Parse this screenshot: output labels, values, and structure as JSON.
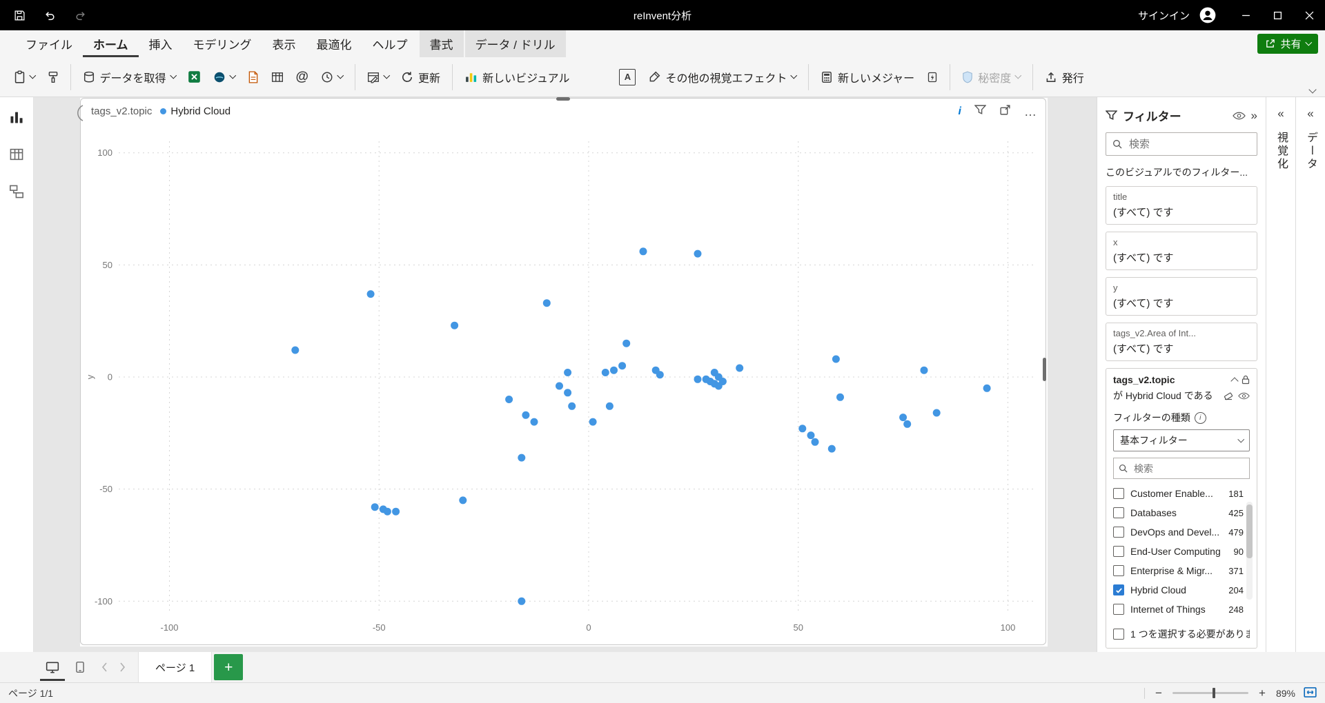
{
  "titlebar": {
    "title": "reInvent分析",
    "signin": "サインイン"
  },
  "ribbon": {
    "tabs": [
      {
        "label": "ファイル"
      },
      {
        "label": "ホーム",
        "active": true
      },
      {
        "label": "挿入"
      },
      {
        "label": "モデリング"
      },
      {
        "label": "表示"
      },
      {
        "label": "最適化"
      },
      {
        "label": "ヘルプ"
      },
      {
        "label": "書式",
        "context": true
      },
      {
        "label": "データ / ドリル",
        "context": true
      }
    ],
    "share_label": "共有"
  },
  "toolbar": {
    "get_data": "データを取得",
    "refresh": "更新",
    "new_visual": "新しいビジュアル",
    "more_visuals": "その他の視覚エフェクト",
    "new_measure": "新しいメジャー",
    "sensitivity": "秘密度",
    "publish": "発行"
  },
  "visual": {
    "legend_title": "tags_v2.topic",
    "legend_item": "Hybrid Cloud"
  },
  "chart_data": {
    "type": "scatter",
    "title": "",
    "xlabel": "",
    "ylabel": "y",
    "xlim": [
      -115,
      110
    ],
    "ylim": [
      -108,
      108
    ],
    "xticks": [
      -100,
      -50,
      0,
      50,
      100
    ],
    "yticks": [
      -100,
      -50,
      0,
      50,
      100
    ],
    "grid": "dotted",
    "legend_position": "top-left",
    "point_color": "#4296e3",
    "series": [
      {
        "name": "Hybrid Cloud",
        "points": [
          [
            -52,
            37
          ],
          [
            -70,
            12
          ],
          [
            -32,
            23
          ],
          [
            -10,
            33
          ],
          [
            13,
            56
          ],
          [
            26,
            55
          ],
          [
            9,
            15
          ],
          [
            -5,
            2
          ],
          [
            4,
            2
          ],
          [
            8,
            5
          ],
          [
            6,
            3
          ],
          [
            16,
            3
          ],
          [
            17,
            1
          ],
          [
            26,
            -1
          ],
          [
            28,
            -1
          ],
          [
            29,
            -2
          ],
          [
            30,
            2
          ],
          [
            31,
            0
          ],
          [
            30,
            -3
          ],
          [
            32,
            -2
          ],
          [
            31,
            -4
          ],
          [
            36,
            4
          ],
          [
            59,
            8
          ],
          [
            80,
            3
          ],
          [
            95,
            -5
          ],
          [
            -7,
            -4
          ],
          [
            -5,
            -7
          ],
          [
            -19,
            -10
          ],
          [
            -15,
            -17
          ],
          [
            -13,
            -20
          ],
          [
            -4,
            -13
          ],
          [
            1,
            -20
          ],
          [
            5,
            -13
          ],
          [
            -16,
            -36
          ],
          [
            51,
            -23
          ],
          [
            53,
            -26
          ],
          [
            54,
            -29
          ],
          [
            58,
            -32
          ],
          [
            60,
            -9
          ],
          [
            75,
            -18
          ],
          [
            76,
            -21
          ],
          [
            83,
            -16
          ],
          [
            -30,
            -55
          ],
          [
            -51,
            -58
          ],
          [
            -49,
            -59
          ],
          [
            -48,
            -60
          ],
          [
            -46,
            -60
          ],
          [
            -16,
            -100
          ]
        ]
      }
    ]
  },
  "filters": {
    "title": "フィルター",
    "search_placeholder": "検索",
    "section_label": "このビジュアルでのフィルター...",
    "cards": [
      {
        "field": "title",
        "state": "(すべて) です"
      },
      {
        "field": "x",
        "state": "(すべて) です"
      },
      {
        "field": "y",
        "state": "(すべて) です"
      },
      {
        "field": "tags_v2.Area of Int...",
        "state": "(すべて) です"
      }
    ],
    "active_card": {
      "field": "tags_v2.topic",
      "state": "が Hybrid Cloud である",
      "type_label": "フィルターの種類",
      "type_value": "基本フィルター",
      "search_placeholder": "検索",
      "items": [
        {
          "label": "Customer Enable...",
          "count": "181",
          "checked": false
        },
        {
          "label": "Databases",
          "count": "425",
          "checked": false
        },
        {
          "label": "DevOps and Devel...",
          "count": "479",
          "checked": false
        },
        {
          "label": "End-User Computing",
          "count": "90",
          "checked": false
        },
        {
          "label": "Enterprise & Migr...",
          "count": "371",
          "checked": false
        },
        {
          "label": "Hybrid Cloud",
          "count": "204",
          "checked": true
        },
        {
          "label": "Internet of Things",
          "count": "248",
          "checked": false
        }
      ],
      "require_single_label": "1 つを選択する必要がありま"
    }
  },
  "right_rails": {
    "visualizations": "視覚化",
    "data": "データ"
  },
  "pagebar": {
    "page_tab": "ページ 1"
  },
  "statusbar": {
    "page_status": "ページ 1/1",
    "zoom": "89%"
  }
}
